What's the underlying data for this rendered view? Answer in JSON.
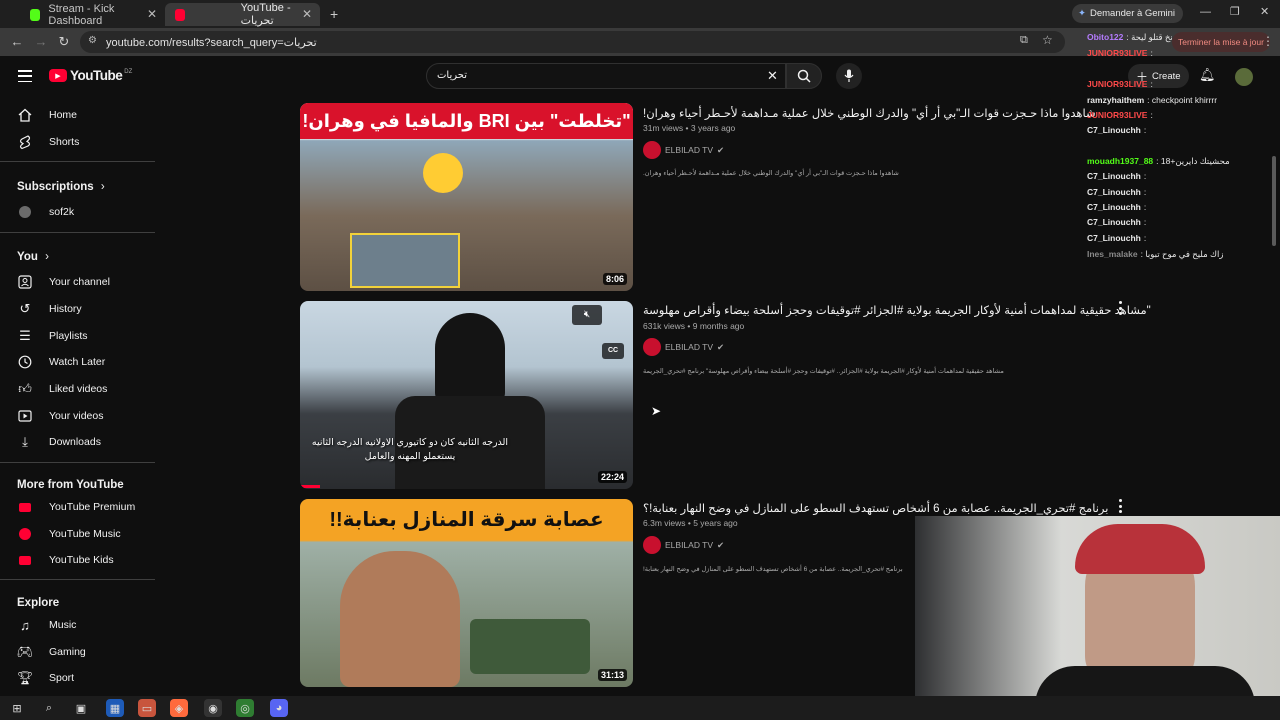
{
  "browser": {
    "tabs": [
      {
        "label": "Stream - Kick Dashboard",
        "active": false,
        "favicon_color": "#53fc18"
      },
      {
        "label": "YouTube - تحريات",
        "active": true,
        "favicon_color": "#ff0033"
      }
    ],
    "new_tab": "+",
    "gemini_button": "Demander à Gemini",
    "url": "youtube.com/results?search_query=تحريات",
    "update_button": "Terminer la mise à jour"
  },
  "youtube": {
    "logo": "YouTube",
    "region": "DZ",
    "search": {
      "value": "تحريات"
    },
    "create_label": "Create"
  },
  "sidebar": {
    "main": [
      {
        "label": "Home",
        "icon": "home-icon"
      },
      {
        "label": "Shorts",
        "icon": "shorts-icon"
      }
    ],
    "subscriptions_header": "Subscriptions",
    "subscriptions": [
      {
        "label": "sof2k"
      }
    ],
    "you_header": "You",
    "you": [
      {
        "label": "Your channel",
        "icon": "channel-icon"
      },
      {
        "label": "History",
        "icon": "history-icon"
      },
      {
        "label": "Playlists",
        "icon": "playlists-icon"
      },
      {
        "label": "Watch Later",
        "icon": "watch-later-icon"
      },
      {
        "label": "Liked videos",
        "icon": "like-icon"
      },
      {
        "label": "Your videos",
        "icon": "video-icon"
      },
      {
        "label": "Downloads",
        "icon": "download-icon"
      }
    ],
    "more_header": "More from YouTube",
    "more": [
      {
        "label": "YouTube Premium"
      },
      {
        "label": "YouTube Music"
      },
      {
        "label": "YouTube Kids"
      }
    ],
    "explore_header": "Explore",
    "explore": [
      {
        "label": "Music",
        "icon": "music-icon"
      },
      {
        "label": "Gaming",
        "icon": "gaming-icon"
      },
      {
        "label": "Sport",
        "icon": "trophy-icon"
      }
    ]
  },
  "videos": [
    {
      "title": "شاهدوا ماذا حـجزت قوات الـ\"بي أر أي\" والدرك الوطني خلال عملية مـداهمة لأحـطر أحياء وهران!",
      "meta": "31m views • 3 years ago",
      "channel": "ELBILAD TV",
      "description": "شاهدوا ماذا حـجزت قوات الـ\"بي أر أي\" والدرك الوطني خلال عملية مـداهمة لأحـطر أحياء وهران.",
      "duration": "8:06",
      "thumb_text": "\"تخلطت\" بين BRI والمافيا في وهران!"
    },
    {
      "title": "\"مشاهد حقيقية لمداهمات أمنية لأوكار الجريمة بولاية #الجزائر #توقيفات وحجز أسلحة بيضاء وأقراص مهلوسة",
      "meta": "631k views • 9 months ago",
      "channel": "ELBILAD TV",
      "description": "مشاهد حقيقية لمداهمات أمنية لأوكار #الجريمة بولاية #الجزائر.. #توقيفات وحجز #أسلحة بيضاء وأقراص مهلوسة\" برنامج #تحري_الجريمة",
      "duration": "22:24",
      "thumb_text": "الدرجه الثانيه كان دو كاتيوري الاولانيه الدرجه الثانيه يستعملو المهنه والعامل"
    },
    {
      "title": "برنامج #تحري_الجريمة.. عصابة من 6 أشخاص تستهدف السطو على المنازل في وضح النهار بعنابة!؟",
      "meta": "6.3m views • 5 years ago",
      "channel": "ELBILAD TV",
      "description": "برنامج #تحري_الجريمة.. عصابة من 6 أشخاص تستهدف السطو على المنازل في وضح النهار بعنابة!",
      "duration": "31:13",
      "thumb_text": "عصابة سرقة المنازل بعنابة!!"
    }
  ],
  "chat": [
    {
      "user": "Obito122",
      "text": ": نخ قتلو ليحة",
      "color": "#b57cff"
    },
    {
      "user": "JUNIOR93LIVE",
      "text": ":",
      "color": "#ff4a4a"
    },
    {
      "user": "JUNIOR93LIVE",
      "text": ":",
      "color": "#ff4a4a"
    },
    {
      "user": "ramzyhaithem",
      "text": ": checkpoint khirrrr",
      "color": "#e8e8e8"
    },
    {
      "user": "JUNIOR93LIVE",
      "text": ":",
      "color": "#ff4a4a"
    },
    {
      "user": "C7_Linouchh",
      "text": ":",
      "color": "#e8e8e8"
    },
    {
      "user": "mouadh1937_88",
      "text": ": محشيتك دايرين+18",
      "color": "#53fc18"
    },
    {
      "user": "C7_Linouchh",
      "text": ":",
      "color": "#e8e8e8"
    },
    {
      "user": "C7_Linouchh",
      "text": ":",
      "color": "#e8e8e8"
    },
    {
      "user": "C7_Linouchh",
      "text": ":",
      "color": "#e8e8e8"
    },
    {
      "user": "C7_Linouchh",
      "text": ":",
      "color": "#e8e8e8"
    },
    {
      "user": "C7_Linouchh",
      "text": ":",
      "color": "#e8e8e8"
    },
    {
      "user": "Ines_malake",
      "text": ": زاك مليح في موح تبوبا",
      "color": "#8a8a8a"
    }
  ],
  "colors": {
    "yt_red": "#ff0033",
    "bg": "#0f0f0f",
    "chrome": "#1f1f1f"
  }
}
